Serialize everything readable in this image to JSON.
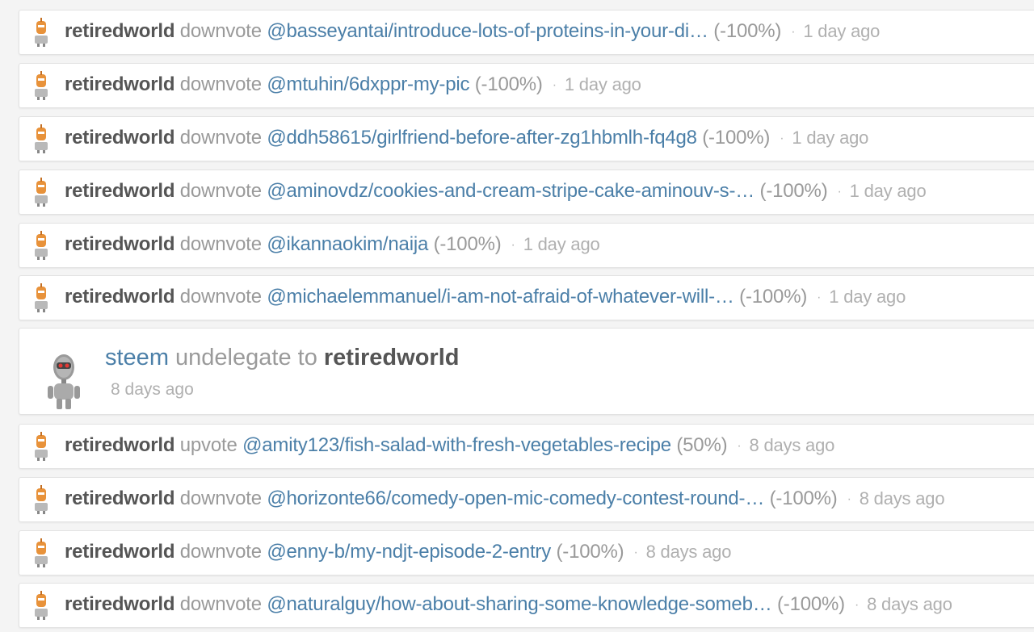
{
  "activities": [
    {
      "user": "retiredworld",
      "action": "downvote",
      "target": "@basseyantai/introduce-lots-of-proteins-in-your-di…",
      "weight": "(-100%)",
      "time": "1 day ago"
    },
    {
      "user": "retiredworld",
      "action": "downvote",
      "target": "@mtuhin/6dxppr-my-pic",
      "weight": "(-100%)",
      "time": "1 day ago"
    },
    {
      "user": "retiredworld",
      "action": "downvote",
      "target": "@ddh58615/girlfriend-before-after-zg1hbmlh-fq4g8",
      "weight": "(-100%)",
      "time": "1 day ago"
    },
    {
      "user": "retiredworld",
      "action": "downvote",
      "target": "@aminovdz/cookies-and-cream-stripe-cake-aminouv-s-…",
      "weight": "(-100%)",
      "time": "1 day ago"
    },
    {
      "user": "retiredworld",
      "action": "downvote",
      "target": "@ikannaokim/naija",
      "weight": "(-100%)",
      "time": "1 day ago"
    },
    {
      "user": "retiredworld",
      "action": "downvote",
      "target": "@michaelemmanuel/i-am-not-afraid-of-whatever-will-…",
      "weight": "(-100%)",
      "time": "1 day ago"
    }
  ],
  "delegation": {
    "from": "steem",
    "action": "undelegate to",
    "to": "retiredworld",
    "time": "8 days ago"
  },
  "activities2": [
    {
      "user": "retiredworld",
      "action": "upvote",
      "target": "@amity123/fish-salad-with-fresh-vegetables-recipe",
      "weight": "(50%)",
      "time": "8 days ago"
    },
    {
      "user": "retiredworld",
      "action": "downvote",
      "target": "@horizonte66/comedy-open-mic-comedy-contest-round-…",
      "weight": "(-100%)",
      "time": "8 days ago"
    },
    {
      "user": "retiredworld",
      "action": "downvote",
      "target": "@enny-b/my-ndjt-episode-2-entry",
      "weight": "(-100%)",
      "time": "8 days ago"
    },
    {
      "user": "retiredworld",
      "action": "downvote",
      "target": "@naturalguy/how-about-sharing-some-knowledge-someb…",
      "weight": "(-100%)",
      "time": "8 days ago"
    }
  ],
  "separator": "·",
  "colors": {
    "link": "#4b7fa8",
    "user": "#555555",
    "muted": "#9a9a9a",
    "avatar_orange": "#e8923a"
  }
}
